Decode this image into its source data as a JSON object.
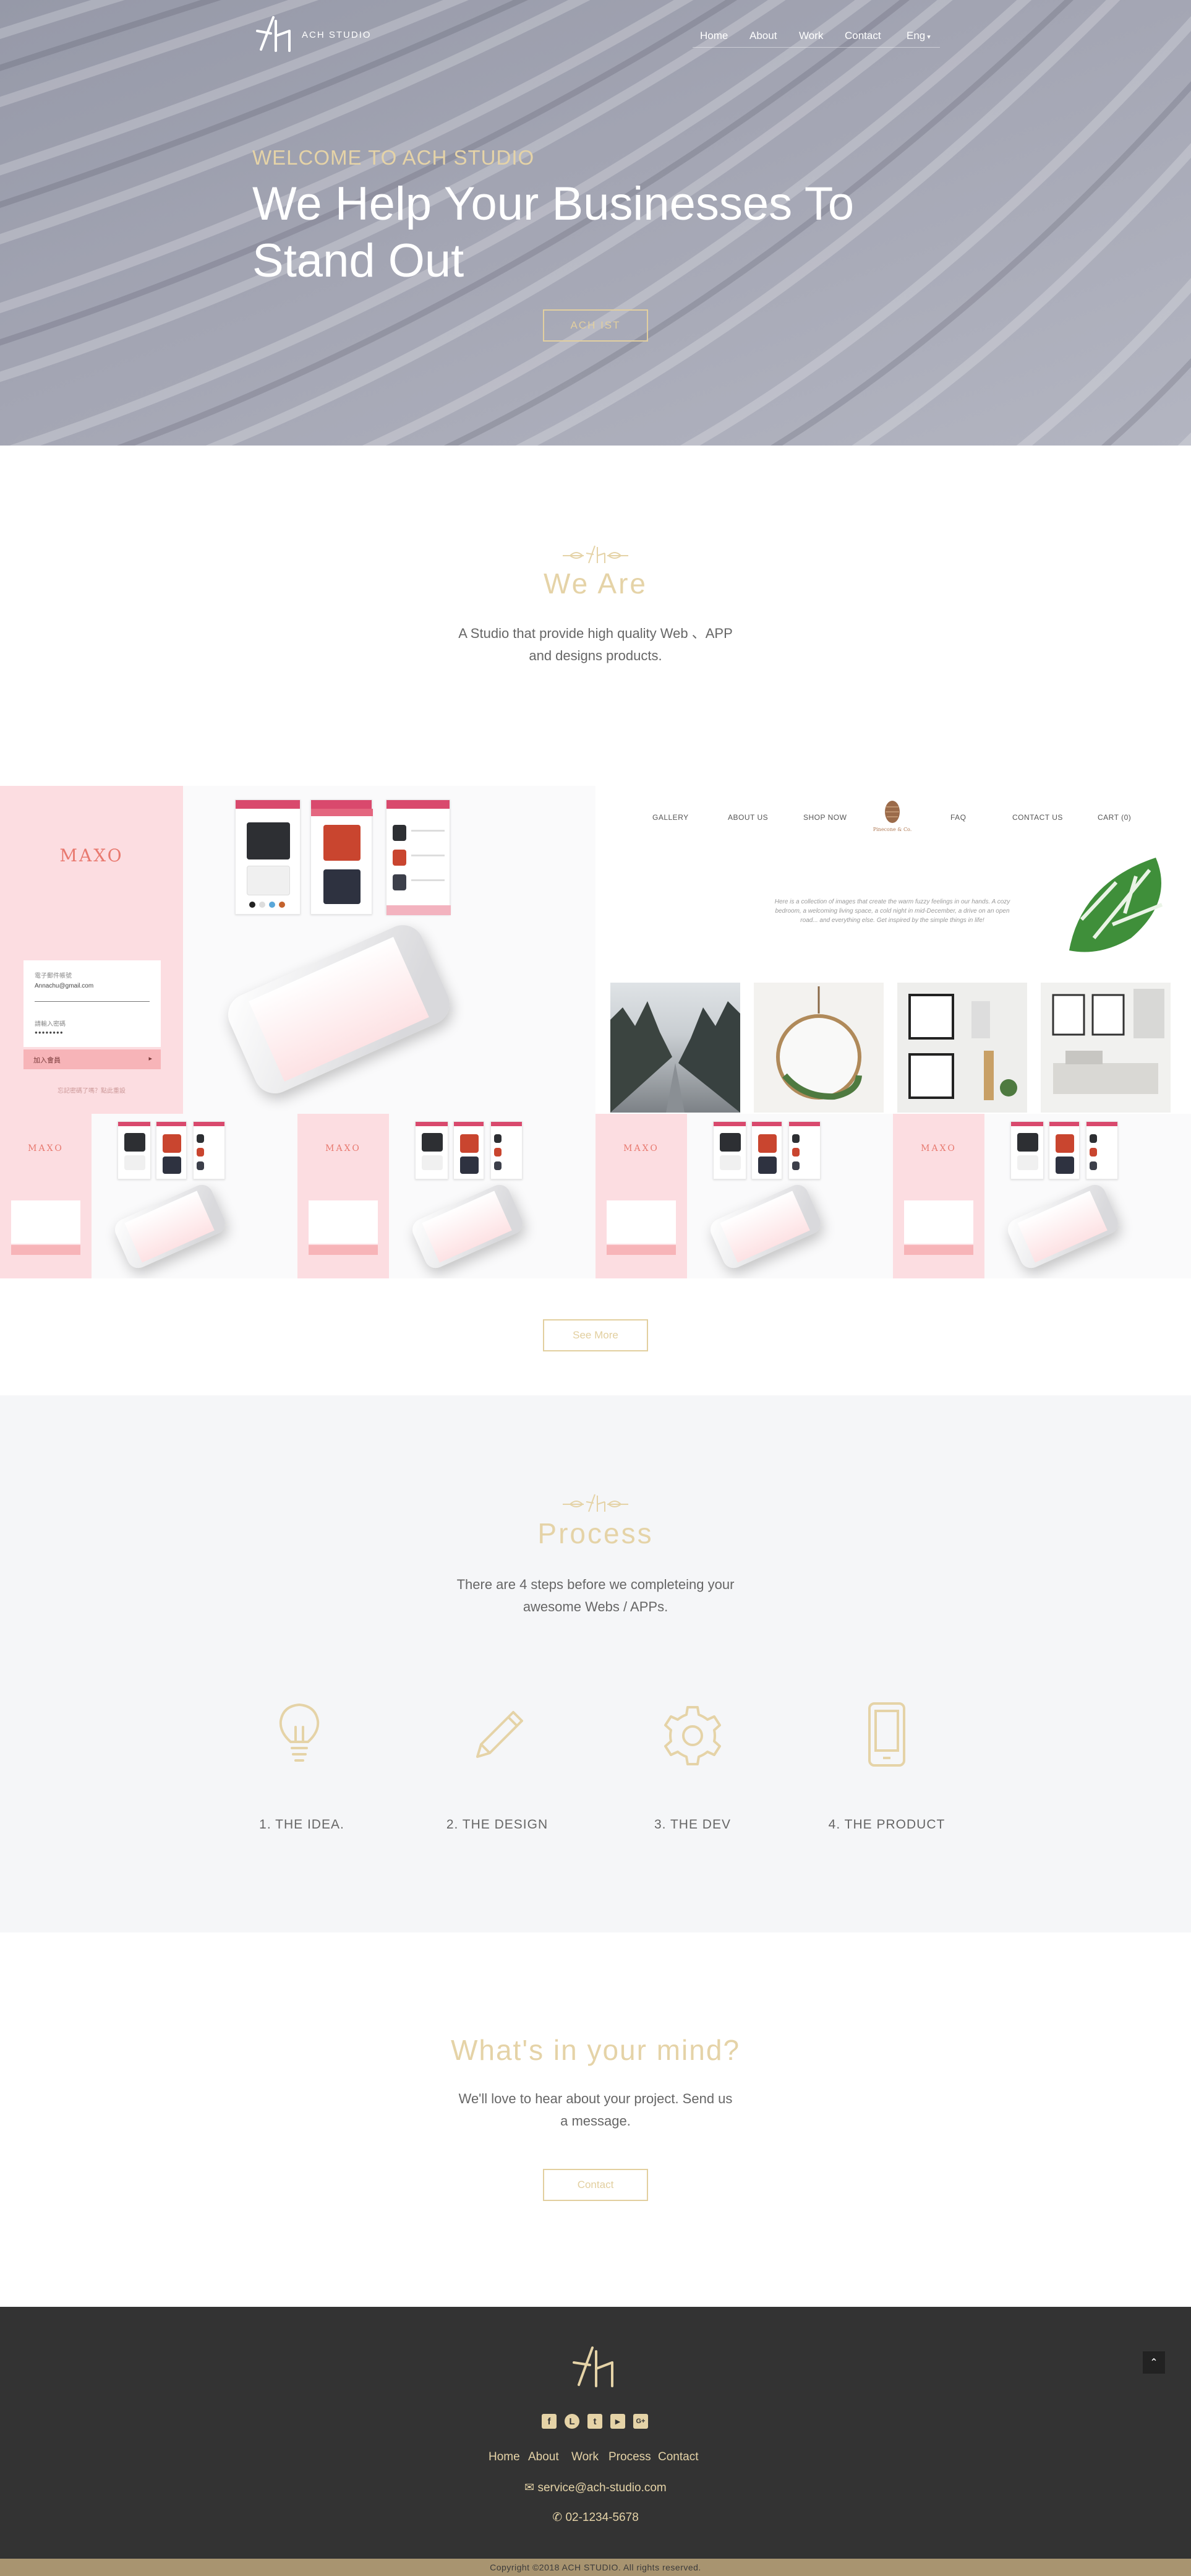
{
  "brand": {
    "name": "ACH STUDIO"
  },
  "nav": {
    "items": [
      "Home",
      "About",
      "Work",
      "Contact",
      "Eng"
    ],
    "lang_caret": "▾"
  },
  "hero": {
    "welcome": "WELCOME TO ACH STUDIO",
    "title_line1": "We Help Your Businesses To",
    "title_line2": "Stand Out",
    "button": "ACH IST"
  },
  "we_are": {
    "title": "We Are",
    "text_line1": "A Studio that provide high quality Web 、APP",
    "text_line2": "and designs products."
  },
  "portfolio": {
    "maxo": {
      "brand": "MAXO",
      "email_label": "電子郵件帳號",
      "email_value": "Annachu@gmail.com",
      "password_label": "請輸入密碼",
      "password_value": "●●●●●●●●",
      "login_button": "加入會員",
      "forgot": "忘記密碼了嗎？點此重設"
    },
    "gallery": {
      "nav": [
        "GALLERY",
        "ABOUT US",
        "SHOP NOW",
        "FAQ",
        "CONTACT US",
        "CART (0)"
      ],
      "brand": "Pinecone & Co.",
      "text_line1": "Here is a collection of images that create the warm fuzzy feelings in our hands. A cozy",
      "text_line2": "bedroom, a welcoming living space, a cold night in mid-December, a drive on an open",
      "text_line3": "road... and everything else. Get inspired by the simple things in life!"
    },
    "see_more": "See More"
  },
  "process": {
    "title": "Process",
    "text_line1": "There are 4 steps before we completeing your",
    "text_line2": "awesome Webs / APPs.",
    "steps": [
      {
        "label": "1. THE IDEA.",
        "icon": "lightbulb-icon"
      },
      {
        "label": "2. THE DESIGN",
        "icon": "pencil-icon"
      },
      {
        "label": "3. THE DEV",
        "icon": "gear-icon"
      },
      {
        "label": "4. THE PRODUCT",
        "icon": "smartphone-icon"
      }
    ]
  },
  "mind": {
    "title": "What's in your mind?",
    "text_line1": "We'll love to hear about your project. Send us",
    "text_line2": "a message.",
    "button": "Contact"
  },
  "footer": {
    "social": [
      {
        "icon": "facebook-icon",
        "glyph": "f"
      },
      {
        "icon": "line-icon",
        "glyph": "L"
      },
      {
        "icon": "twitter-icon",
        "glyph": "t"
      },
      {
        "icon": "youtube-icon",
        "glyph": "▶"
      },
      {
        "icon": "google-plus-icon",
        "glyph": "G+"
      }
    ],
    "nav": [
      "Home",
      "About",
      "Work",
      "Process",
      "Contact"
    ],
    "email": "service@ach-studio.com",
    "phone": "02-1234-5678",
    "copyright": "Copyright ©2018 ACH STUDIO. All rights reserved.",
    "to_top": "⌃"
  },
  "colors": {
    "accent_gold": "#e5d3a7",
    "hero_gray": "#9fa1af",
    "footer_dark": "#333333",
    "copy_bar": "#a89470",
    "maxo_pink": "#fcdde1",
    "maxo_red": "#d9496d"
  }
}
